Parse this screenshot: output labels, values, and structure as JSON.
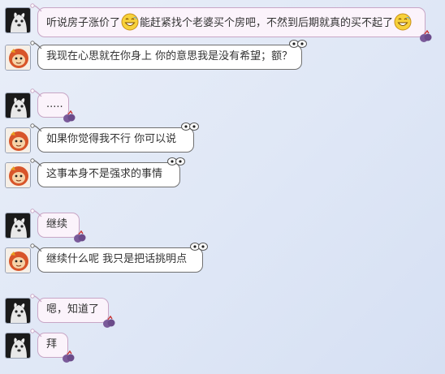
{
  "messages": [
    {
      "side": "left",
      "avatar": "dog-avatar-icon",
      "style": "pink",
      "parts": [
        "听说房子涨价了",
        "能赶紧找个老婆买个房吧，不然到后期就真的买不起了"
      ],
      "emoji": "grin-emoji-icon"
    },
    {
      "side": "left",
      "avatar": "monkey-avatar-icon",
      "style": "white",
      "text": "我现在心思就在你身上 你的意思我是没有希望；额？"
    },
    {
      "side": "left",
      "avatar": "dog-avatar-icon",
      "style": "pink",
      "text": "....."
    },
    {
      "side": "left",
      "avatar": "monkey-avatar-icon",
      "style": "white",
      "text": "如果你觉得我不行 你可以说"
    },
    {
      "side": "left",
      "avatar": "monkey-avatar-icon",
      "style": "white",
      "text": "这事本身不是强求的事情"
    },
    {
      "side": "left",
      "avatar": "dog-avatar-icon",
      "style": "pink",
      "text": "继续"
    },
    {
      "side": "left",
      "avatar": "monkey-avatar-icon",
      "style": "white",
      "text": "继续什么呢 我只是把话挑明点"
    },
    {
      "side": "left",
      "avatar": "dog-avatar-icon",
      "style": "pink",
      "text": "嗯，知道了"
    },
    {
      "side": "left",
      "avatar": "dog-avatar-icon",
      "style": "pink",
      "text": "拜"
    }
  ],
  "colors": {
    "pink_bubble": "#fbf3fb",
    "pink_border": "#c8a6c6",
    "white_bubble": "#ffffff",
    "white_border": "#707070",
    "background": "#e3e9f6"
  }
}
